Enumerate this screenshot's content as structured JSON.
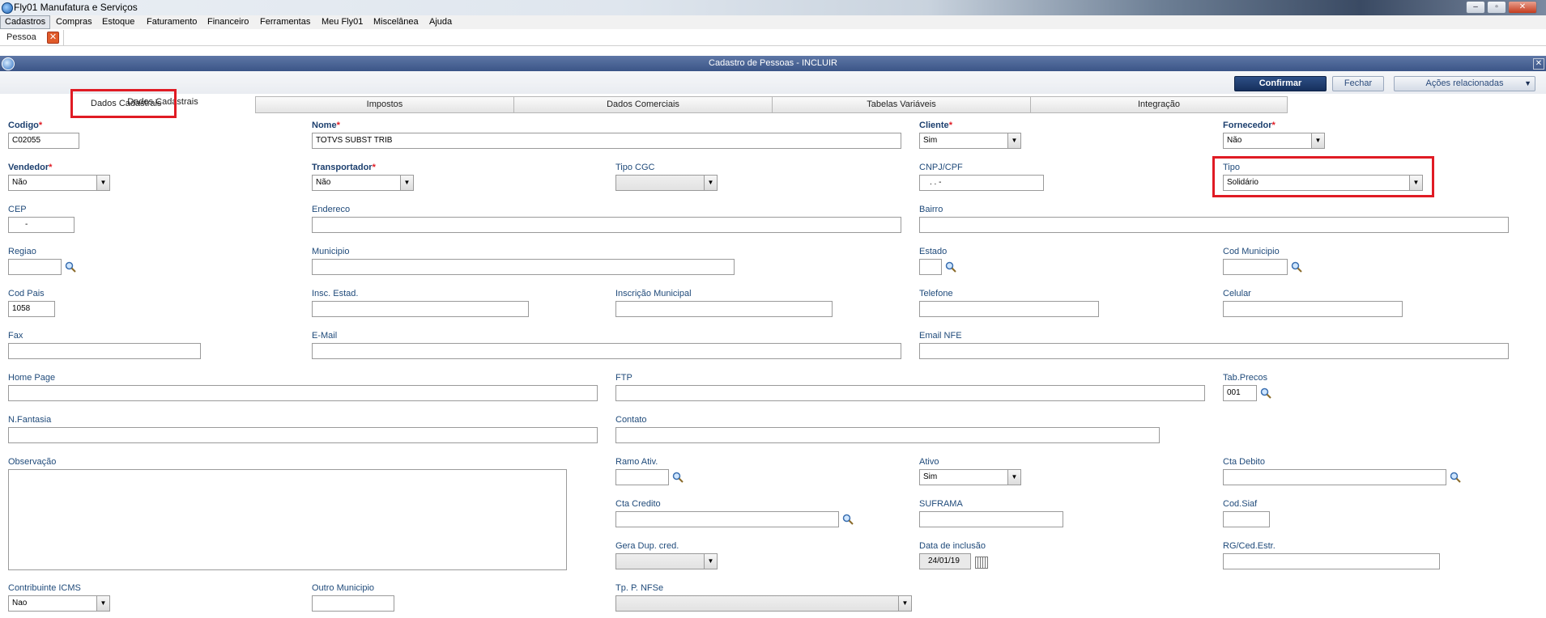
{
  "app": {
    "title": "Fly01 Manufatura e Serviços"
  },
  "menu": [
    {
      "label": "Cadastros"
    },
    {
      "label": "Compras"
    },
    {
      "label": "Estoque"
    },
    {
      "label": "Faturamento"
    },
    {
      "label": "Financeiro"
    },
    {
      "label": "Ferramentas"
    },
    {
      "label": "Meu Fly01"
    },
    {
      "label": "Miscelânea"
    },
    {
      "label": "Ajuda"
    }
  ],
  "doc_tab": {
    "label": "Pessoa"
  },
  "window": {
    "title": "Cadastro de Pessoas - INCLUIR"
  },
  "toolbar": {
    "confirm": "Confirmar",
    "close": "Fechar",
    "actions": "Ações relacionadas"
  },
  "tabs": [
    "Dados Cadastrais",
    "Impostos",
    "Dados Comerciais",
    "Tabelas Variáveis",
    "Integração"
  ],
  "form": {
    "codigo": {
      "label": "Codigo",
      "value": "C02055"
    },
    "nome": {
      "label": "Nome",
      "value": "TOTVS SUBST TRIB"
    },
    "cliente": {
      "label": "Cliente",
      "value": "Sim"
    },
    "fornecedor": {
      "label": "Fornecedor",
      "value": "Não"
    },
    "vendedor": {
      "label": "Vendedor",
      "value": "Não"
    },
    "transportador": {
      "label": "Transportador",
      "value": "Não"
    },
    "tipo_cgc": {
      "label": "Tipo CGC",
      "value": ""
    },
    "cnpj": {
      "label": "CNPJ/CPF",
      "value": ". . -"
    },
    "tipo": {
      "label": "Tipo",
      "value": "Solidário"
    },
    "cep": {
      "label": "CEP",
      "value": "-"
    },
    "endereco": {
      "label": "Endereco",
      "value": ""
    },
    "bairro": {
      "label": "Bairro",
      "value": ""
    },
    "regiao": {
      "label": "Regiao",
      "value": ""
    },
    "municipio": {
      "label": "Municipio",
      "value": ""
    },
    "estado": {
      "label": "Estado",
      "value": ""
    },
    "cod_municipio": {
      "label": "Cod Municipio",
      "value": ""
    },
    "cod_pais": {
      "label": "Cod Pais",
      "value": "1058"
    },
    "insc_estad": {
      "label": "Insc. Estad.",
      "value": ""
    },
    "insc_municipal": {
      "label": "Inscrição Municipal",
      "value": ""
    },
    "telefone": {
      "label": "Telefone",
      "value": ""
    },
    "celular": {
      "label": "Celular",
      "value": ""
    },
    "fax": {
      "label": "Fax",
      "value": ""
    },
    "email": {
      "label": "E-Mail",
      "value": ""
    },
    "email_nfe": {
      "label": "Email NFE",
      "value": ""
    },
    "home_page": {
      "label": "Home Page",
      "value": ""
    },
    "ftp": {
      "label": "FTP",
      "value": ""
    },
    "tab_precos": {
      "label": "Tab.Precos",
      "value": "001"
    },
    "n_fantasia": {
      "label": "N.Fantasia",
      "value": ""
    },
    "contato": {
      "label": "Contato",
      "value": ""
    },
    "observacao": {
      "label": "Observação",
      "value": ""
    },
    "ramo_ativ": {
      "label": "Ramo Ativ.",
      "value": ""
    },
    "ativo": {
      "label": "Ativo",
      "value": "Sim"
    },
    "cta_debito": {
      "label": "Cta Debito",
      "value": ""
    },
    "cta_credito": {
      "label": "Cta Credito",
      "value": ""
    },
    "suframa": {
      "label": "SUFRAMA",
      "value": ""
    },
    "cod_siaf": {
      "label": "Cod.Siaf",
      "value": ""
    },
    "gera_dup": {
      "label": "Gera Dup. cred.",
      "value": ""
    },
    "data_inclusao": {
      "label": "Data de inclusão",
      "value": "24/01/19"
    },
    "rg": {
      "label": "RG/Ced.Estr.",
      "value": ""
    },
    "contrib_icms": {
      "label": "Contribuinte ICMS",
      "value": "Nao"
    },
    "outro_municipio": {
      "label": "Outro Municipio",
      "value": ""
    },
    "tp_nfse": {
      "label": "Tp. P. NFSe",
      "value": ""
    }
  },
  "icons": {
    "lookup": "magnifier-icon",
    "calendar": "calendar-icon",
    "dropdown": "dropdown-arrow-icon"
  }
}
